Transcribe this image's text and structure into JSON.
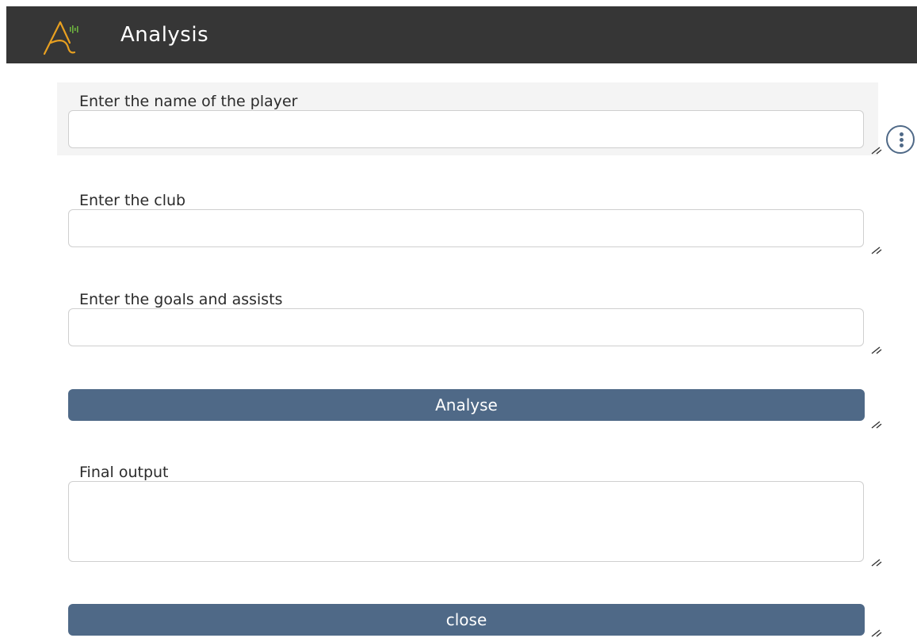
{
  "app": {
    "title": "Analysis",
    "logo_icon": "app-logo-icon",
    "header_color": "#363636"
  },
  "form": {
    "player_name": {
      "label": "Enter the name of the player",
      "value": ""
    },
    "club": {
      "label": "Enter the club",
      "value": ""
    },
    "goals_assists": {
      "label": "Enter the goals and assists",
      "value": ""
    },
    "analyse_button": {
      "label": "Analyse"
    },
    "final_output": {
      "label": "Final output",
      "value": ""
    },
    "close_button": {
      "label": "close"
    }
  },
  "colors": {
    "accent": "#4f6987",
    "logo": "#e8a020",
    "logo_bars": "#6db33f"
  },
  "icons": {
    "widget_menu": "more-vertical-icon",
    "resize": "resize-handle-icon"
  }
}
